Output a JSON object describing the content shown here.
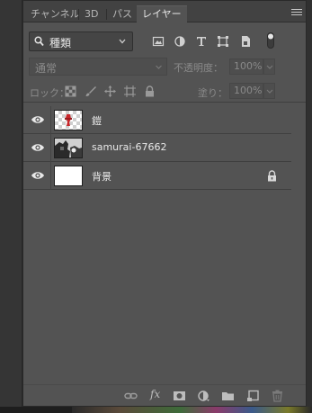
{
  "tabs": [
    {
      "label": "チャンネル",
      "active": false
    },
    {
      "label": "3D",
      "active": false
    },
    {
      "label": "パス",
      "active": false
    },
    {
      "label": "レイヤー",
      "active": true
    }
  ],
  "filter": {
    "kind_label": "種類",
    "icons": [
      "pixel-layer-filter-icon",
      "adjustment-layer-filter-icon",
      "type-layer-filter-icon",
      "shape-layer-filter-icon",
      "smart-object-filter-icon",
      "filter-toggle-icon"
    ]
  },
  "blend": {
    "mode": "通常",
    "opacity_label": "不透明度：",
    "opacity_value": "100%"
  },
  "lock": {
    "label": "ロック：",
    "icons": [
      "lock-transparent-pixels-icon",
      "lock-image-pixels-icon",
      "lock-position-icon",
      "lock-artboard-icon",
      "lock-all-icon"
    ],
    "fill_label": "塗り：",
    "fill_value": "100%"
  },
  "layers": [
    {
      "name": "鎧",
      "thumbnail": "checker",
      "visible": true,
      "locked": false
    },
    {
      "name": "samurai-67662",
      "thumbnail": "photo",
      "visible": true,
      "locked": false
    },
    {
      "name": "背景",
      "thumbnail": "white",
      "visible": true,
      "locked": true
    }
  ],
  "footer_icons": [
    "link-layers-icon",
    "fx-icon",
    "add-mask-icon",
    "new-adjustment-layer-icon",
    "new-group-icon",
    "new-layer-icon",
    "trash-icon"
  ],
  "footer": {
    "fx_label": "fx"
  }
}
